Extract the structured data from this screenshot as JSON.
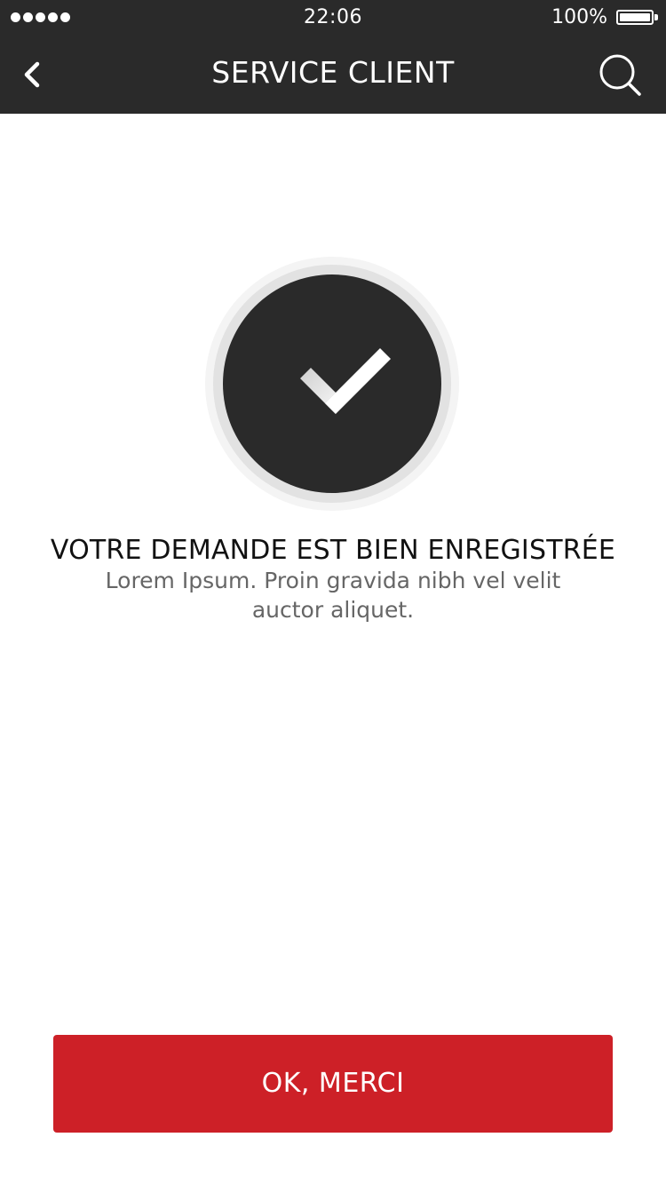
{
  "status_bar": {
    "time": "22:06",
    "battery_percent": "100%",
    "signal_icon": "signal-dots-icon",
    "battery_icon": "battery-full-icon"
  },
  "nav": {
    "title": "SERVICE CLIENT",
    "back_icon": "chevron-left-icon",
    "search_icon": "search-icon"
  },
  "confirmation": {
    "icon": "checkmark-icon",
    "headline": "VOTRE DEMANDE EST BIEN ENREGISTRÉE",
    "subtext": "Lorem Ipsum. Proin gravida nibh vel velit auctor aliquet."
  },
  "actions": {
    "ok_label": "OK, MERCI"
  },
  "colors": {
    "topbar": "#2a2a2a",
    "accent": "#cd2027",
    "circle": "#2a2a2a"
  }
}
